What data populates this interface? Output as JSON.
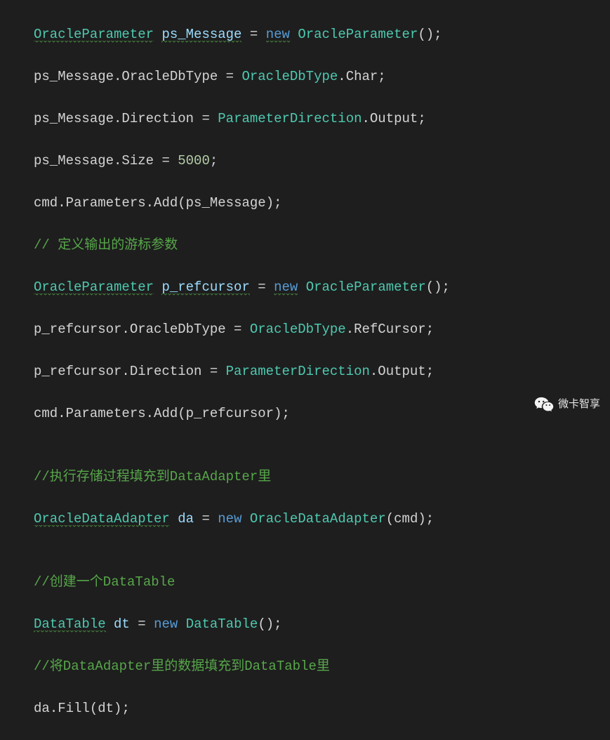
{
  "code": {
    "l1": {
      "t1": "OracleParameter",
      "v1": "ps_Message",
      "eq": " = ",
      "kw": "new",
      "t2": "OracleParameter",
      "end": "();"
    },
    "l2": {
      "v1": "ps_Message",
      "p1": ".OracleDbType = ",
      "t1": "OracleDbType",
      "p2": ".Char;"
    },
    "l3": {
      "v1": "ps_Message",
      "p1": ".Direction = ",
      "t1": "ParameterDirection",
      "p2": ".Output;"
    },
    "l4": {
      "v1": "ps_Message",
      "p1": ".Size = ",
      "n1": "5000",
      "p2": ";"
    },
    "l5": {
      "v1": "cmd",
      "p1": ".Parameters.Add(",
      "v2": "ps_Message",
      "p2": ");"
    },
    "l6": {
      "c": "// 定义输出的游标参数"
    },
    "l7": {
      "t1": "OracleParameter",
      "v1": "p_refcursor",
      "eq": " = ",
      "kw": "new",
      "t2": "OracleParameter",
      "end": "();"
    },
    "l8": {
      "v1": "p_refcursor",
      "p1": ".OracleDbType = ",
      "t1": "OracleDbType",
      "p2": ".RefCursor;"
    },
    "l9": {
      "v1": "p_refcursor",
      "p1": ".Direction = ",
      "t1": "ParameterDirection",
      "p2": ".Output;"
    },
    "l10": {
      "v1": "cmd",
      "p1": ".Parameters.Add(",
      "v2": "p_refcursor",
      "p2": ");"
    },
    "l11": {
      "blank": ""
    },
    "l12": {
      "c": "//执行存储过程填充到DataAdapter里"
    },
    "l13": {
      "t1": "OracleDataAdapter",
      "v1": "da",
      "eq": " = ",
      "kw": "new",
      "t2": "OracleDataAdapter",
      "end": "(cmd);"
    },
    "l14": {
      "blank": ""
    },
    "l15": {
      "c": "//创建一个DataTable"
    },
    "l16": {
      "t1": "DataTable",
      "v1": "dt",
      "eq": " = ",
      "kw": "new",
      "t2": "DataTable",
      "end": "();"
    },
    "l17": {
      "c": "//将DataAdapter里的数据填充到DataTable里"
    },
    "l18": {
      "v1": "da",
      "p1": ".Fill(",
      "v2": "dt",
      "p2": ");"
    }
  },
  "watermark": {
    "text": "微卡智享"
  }
}
